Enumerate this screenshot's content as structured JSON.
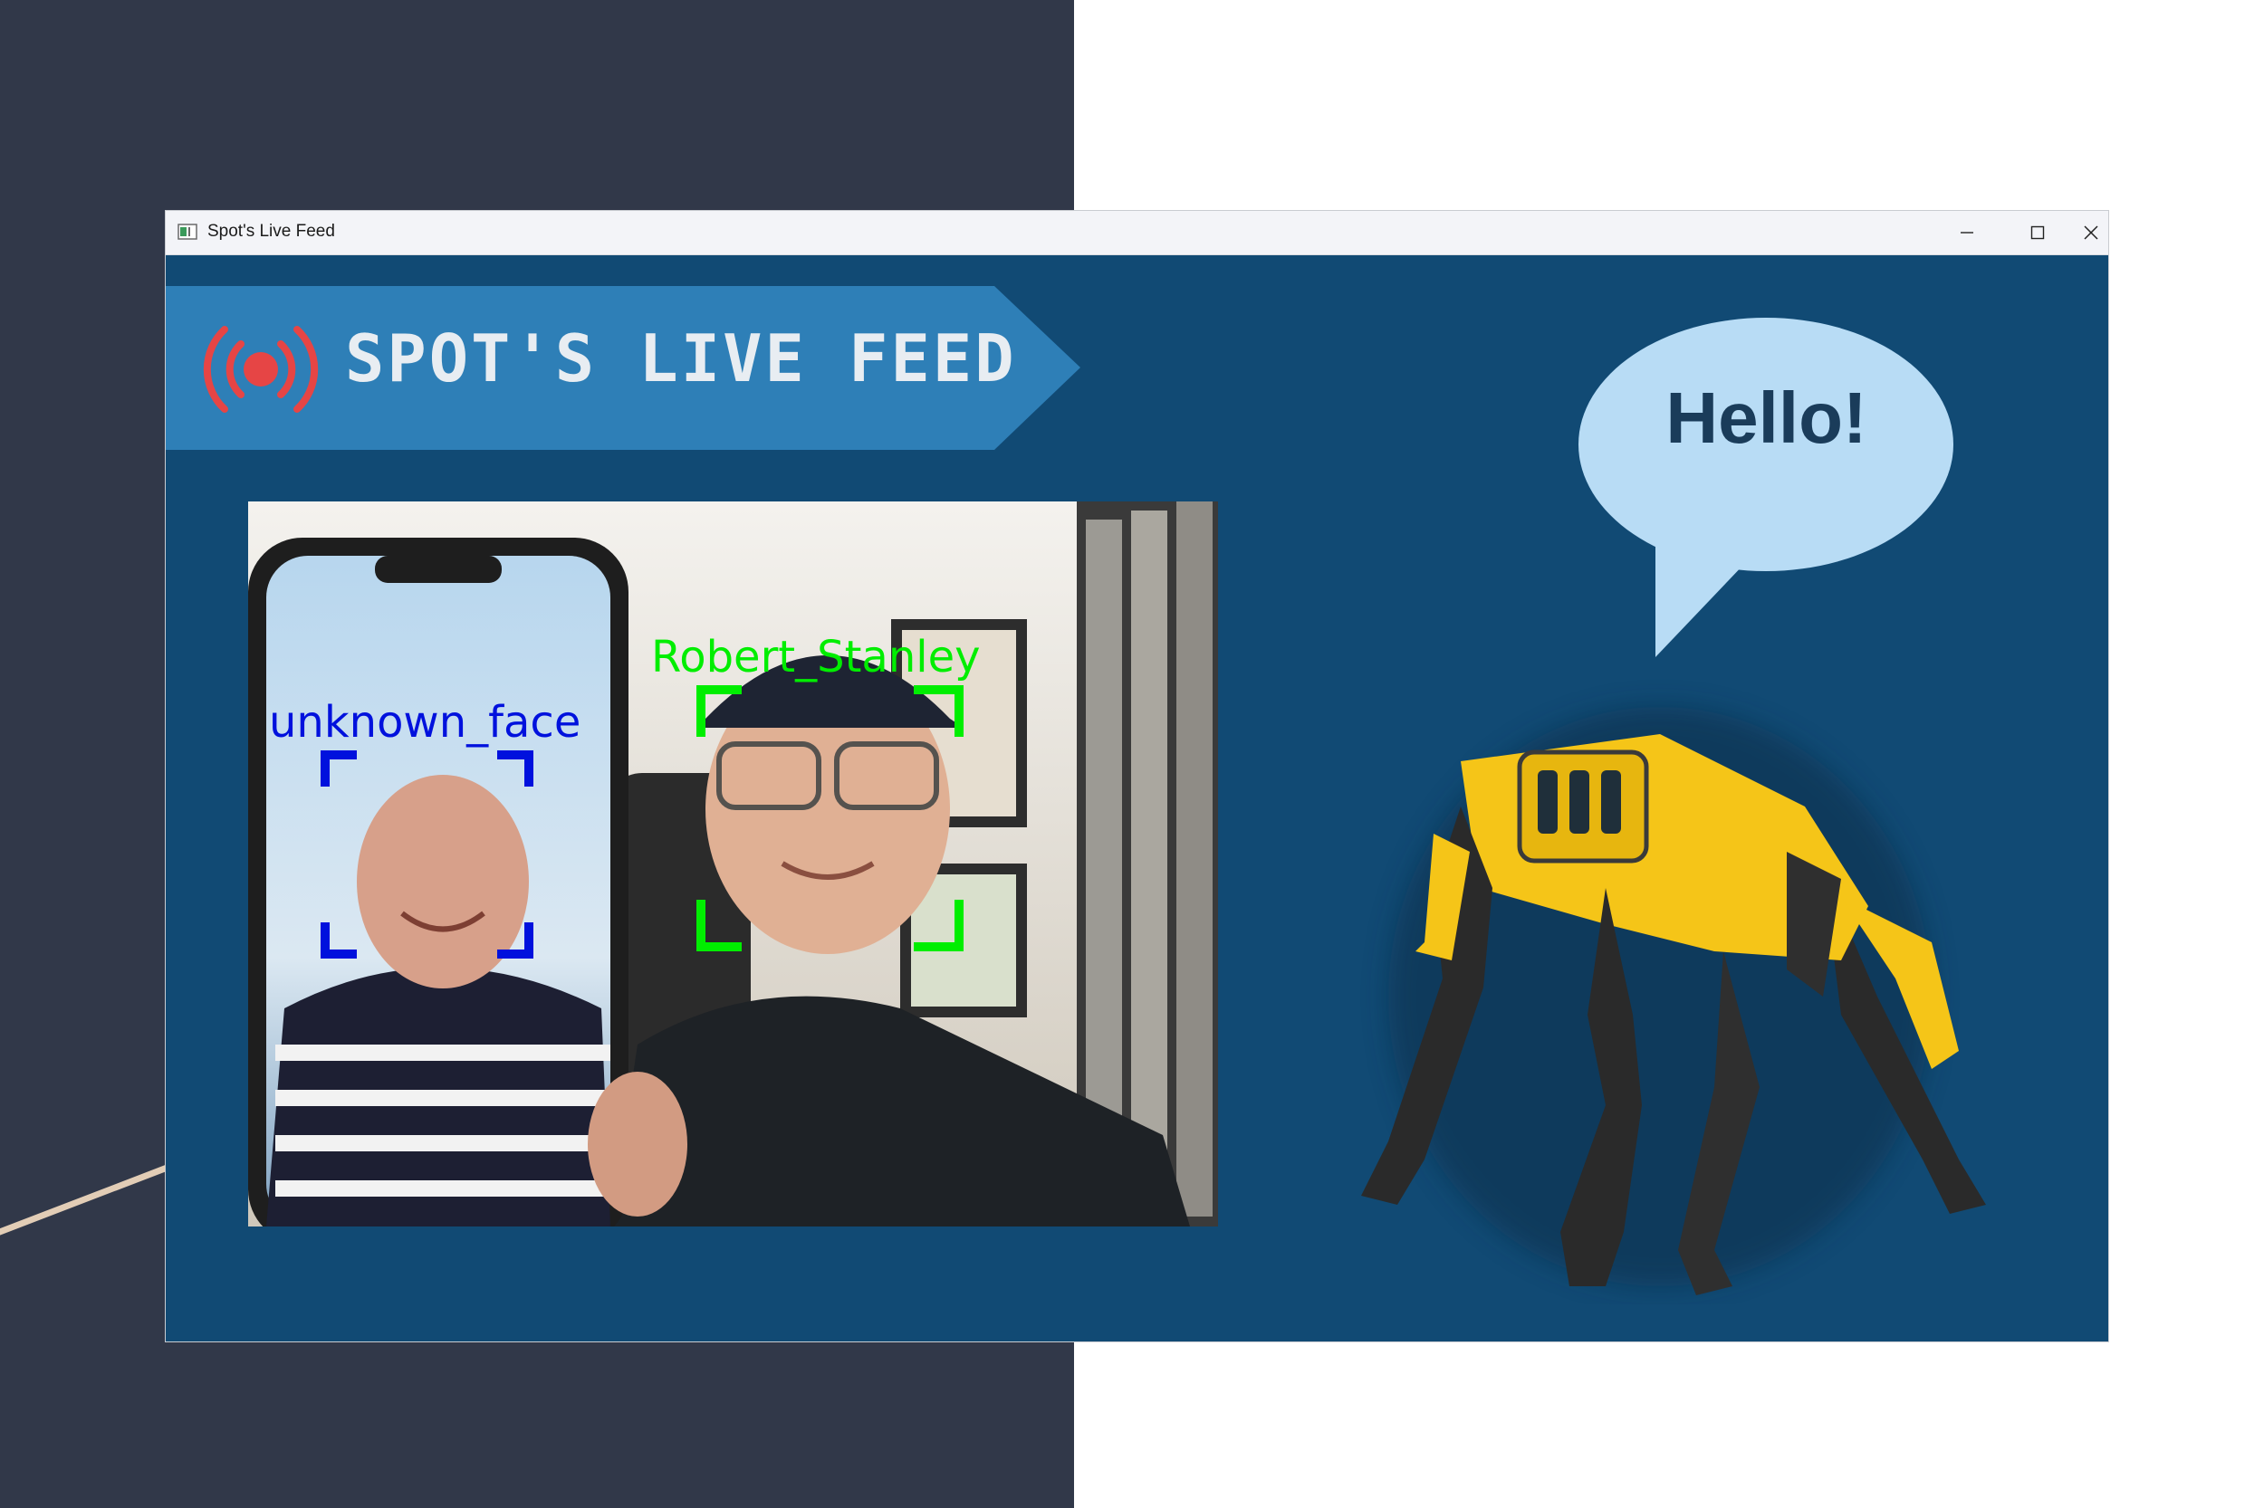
{
  "window": {
    "title": "Spot's Live Feed",
    "controls": {
      "minimize": "minimize-icon",
      "maximize": "maximize-icon",
      "close": "close-icon"
    }
  },
  "banner": {
    "icon": "live-broadcast-icon",
    "title": "SPOT'S LIVE FEED"
  },
  "feed": {
    "detections": [
      {
        "label": "unknown_face",
        "color": "#0011dd"
      },
      {
        "label": "Robert_Stanley",
        "color": "#00ee00"
      }
    ]
  },
  "speech_bubble": {
    "text": "Hello!"
  },
  "colors": {
    "background_dark": "#313849",
    "window_background": "#114a74",
    "banner": "#2e7fb7",
    "live_icon": "#e64545",
    "bubble": "#b8dcf5",
    "robot": "#f5c518"
  }
}
